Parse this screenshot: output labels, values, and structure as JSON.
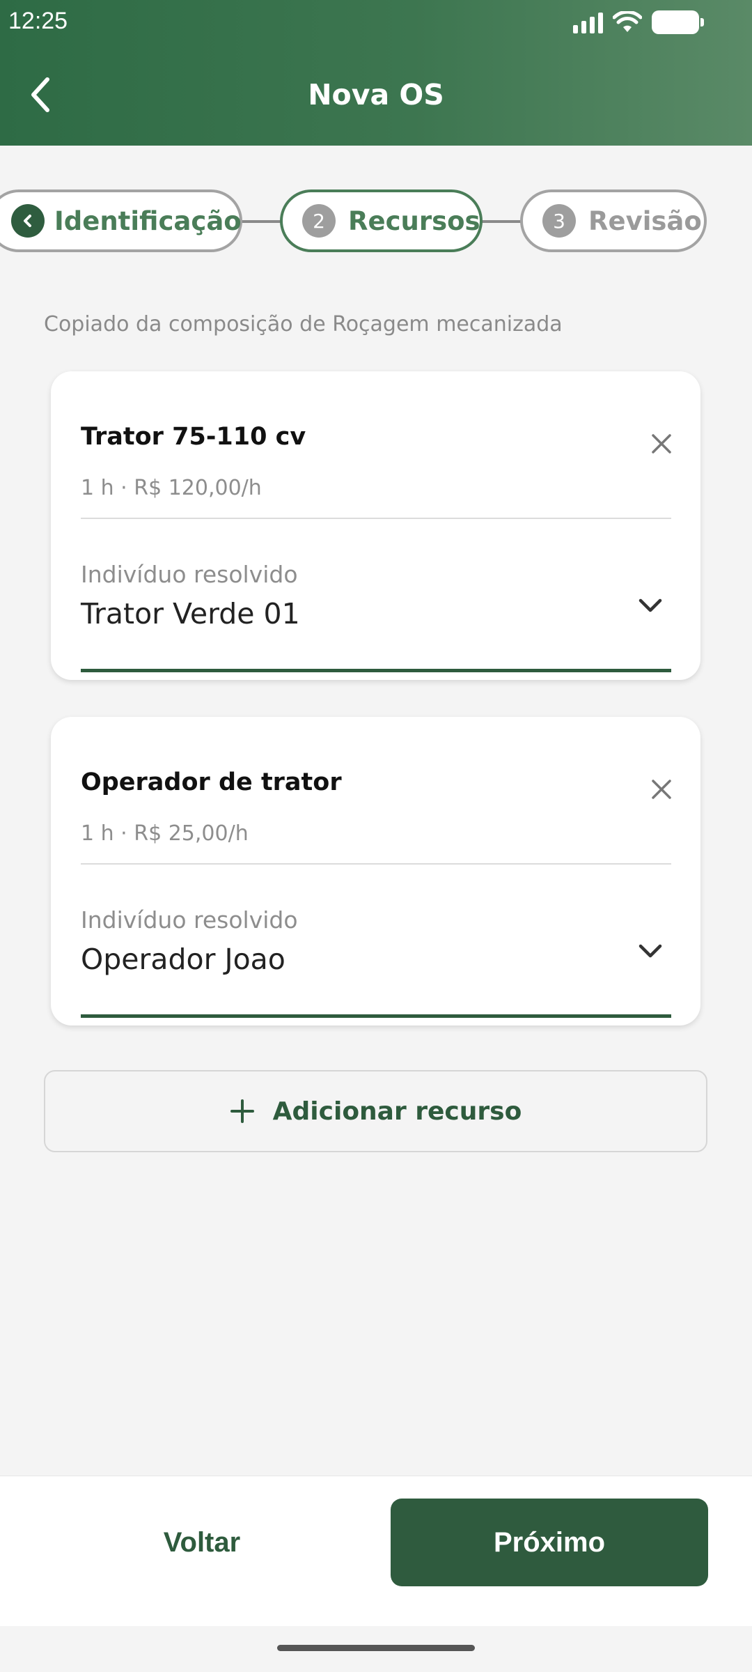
{
  "status_bar": {
    "time": "12:25"
  },
  "header": {
    "title": "Nova OS"
  },
  "stepper": {
    "steps": [
      {
        "label": "Identificação",
        "state": "completed"
      },
      {
        "number": "2",
        "label": "Recursos",
        "state": "active"
      },
      {
        "number": "3",
        "label": "Revisão",
        "state": "upcoming"
      }
    ]
  },
  "source_note": "Copiado da composição de Roçagem mecanizada",
  "resources": [
    {
      "name": "Trator 75-110 cv",
      "meta": "1 h · R$ 120,00/h",
      "select_label": "Indivíduo resolvido",
      "select_value": "Trator Verde 01"
    },
    {
      "name": "Operador de trator",
      "meta": "1 h · R$ 25,00/h",
      "select_label": "Indivíduo resolvido",
      "select_value": "Operador Joao"
    }
  ],
  "add_resource_label": "Adicionar recurso",
  "footer": {
    "back_label": "Voltar",
    "next_label": "Próximo"
  },
  "colors": {
    "brand_green": "#2f5b3e",
    "header_green": "#3d7650",
    "step_active": "#4a7d58",
    "muted_gray": "#8d8d8d"
  }
}
